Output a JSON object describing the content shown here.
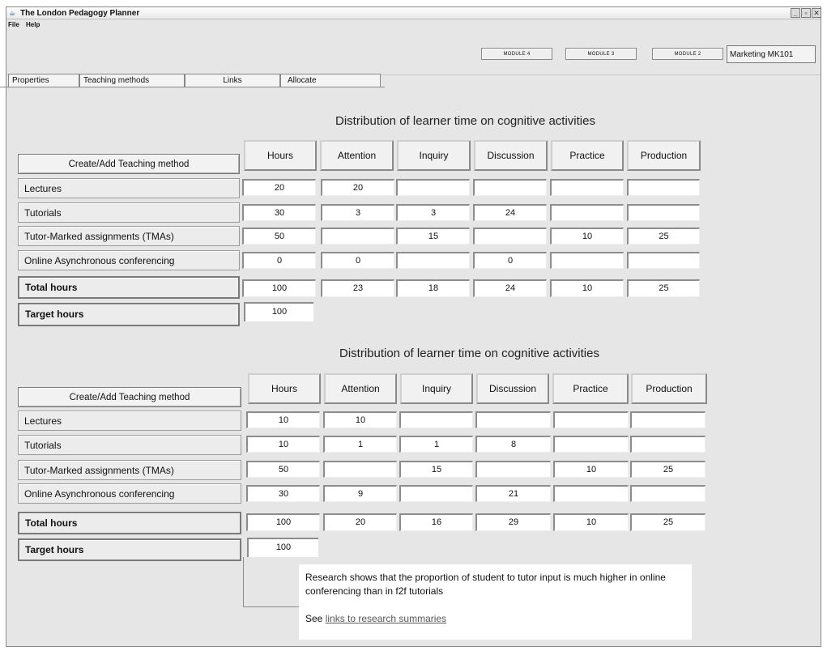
{
  "window": {
    "title": "The London Pedagogy Planner",
    "app_icon": "java-icon"
  },
  "menu": [
    "File",
    "Help"
  ],
  "modules": [
    "MODULE 4",
    "MODULE 3",
    "MODULE 2"
  ],
  "module_name": "Marketing MK101",
  "tabs": [
    "Properties",
    "Teaching methods",
    "Links",
    "Allocate"
  ],
  "table1": {
    "title": "Distribution of learner time on cognitive activities",
    "create_label": "Create/Add Teaching method",
    "columns": [
      "Hours",
      "Attention",
      "Inquiry",
      "Discussion",
      "Practice",
      "Production"
    ],
    "rows": [
      {
        "label": "Lectures",
        "values": [
          "20",
          "20",
          "",
          "",
          "",
          ""
        ]
      },
      {
        "label": "Tutorials",
        "values": [
          "30",
          "3",
          "3",
          "24",
          "",
          ""
        ]
      },
      {
        "label": "Tutor-Marked assignments (TMAs)",
        "values": [
          "50",
          "",
          "15",
          "",
          "10",
          "25"
        ]
      },
      {
        "label": "Online Asynchronous conferencing",
        "values": [
          "0",
          "0",
          "",
          "0",
          "",
          ""
        ]
      }
    ],
    "total": {
      "label": "Total hours",
      "values": [
        "100",
        "23",
        "18",
        "24",
        "10",
        "25"
      ]
    },
    "target": {
      "label": "Target hours",
      "value": "100"
    }
  },
  "table2": {
    "title": "Distribution of learner time on cognitive activities",
    "create_label": "Create/Add Teaching method",
    "columns": [
      "Hours",
      "Attention",
      "Inquiry",
      "Discussion",
      "Practice",
      "Production"
    ],
    "rows": [
      {
        "label": "Lectures",
        "values": [
          "10",
          "10",
          "",
          "",
          "",
          ""
        ]
      },
      {
        "label": "Tutorials",
        "values": [
          "10",
          "1",
          "1",
          "8",
          "",
          ""
        ]
      },
      {
        "label": "Tutor-Marked assignments (TMAs)",
        "values": [
          "50",
          "",
          "15",
          "",
          "10",
          "25"
        ]
      },
      {
        "label": "Online Asynchronous conferencing",
        "values": [
          "30",
          "9",
          "",
          "21",
          "",
          ""
        ]
      }
    ],
    "total": {
      "label": "Total hours",
      "values": [
        "100",
        "20",
        "16",
        "29",
        "10",
        "25"
      ]
    },
    "target": {
      "label": "Target  hours",
      "value": "100"
    }
  },
  "note": {
    "text": "Research shows that the proportion of student to tutor input is much higher in online conferencing than in f2f tutorials",
    "see": "See",
    "link": "links to research summaries"
  }
}
